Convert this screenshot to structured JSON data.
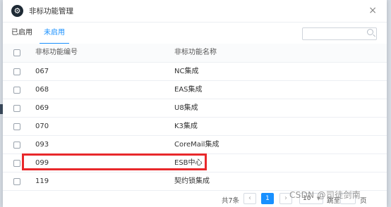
{
  "dialog": {
    "title": "非标功能管理",
    "close_glyph": "×"
  },
  "tabs": [
    {
      "label": "已启用"
    },
    {
      "label": "未启用"
    }
  ],
  "search": {
    "placeholder": ""
  },
  "table": {
    "headers": {
      "code": "非标功能编号",
      "name": "非标功能名称"
    },
    "rows": [
      {
        "code": "067",
        "name": "NC集成"
      },
      {
        "code": "068",
        "name": "EAS集成"
      },
      {
        "code": "069",
        "name": "U8集成"
      },
      {
        "code": "070",
        "name": "K3集成"
      },
      {
        "code": "093",
        "name": "CoreMail集成"
      },
      {
        "code": "099",
        "name": "ESB中心"
      },
      {
        "code": "119",
        "name": "契约锁集成"
      }
    ]
  },
  "pagination": {
    "total": "共7条",
    "prev": "‹",
    "current_page": "1",
    "next": "›",
    "page_size": "10",
    "jump_label": "跳至",
    "page_suffix": "页"
  },
  "watermark": "CSDN @司徒剑南",
  "colors": {
    "accent": "#1890ff",
    "highlight_border": "#e8282b"
  }
}
